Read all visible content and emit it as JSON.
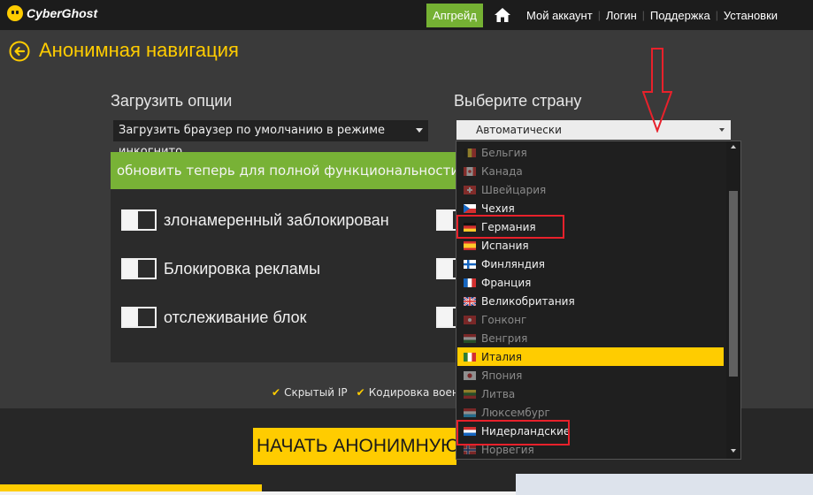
{
  "header": {
    "brand": "CyberGhost",
    "upgrade_label": "Апгрейд",
    "nav": [
      "Мой аккаунт",
      "Логин",
      "Поддержка",
      "Установки"
    ]
  },
  "page": {
    "title": "Анонимная навигация"
  },
  "load_options": {
    "label": "Загрузить опции",
    "selected": "Загрузить браузер по умолчанию в режиме инкогнито"
  },
  "upgrade_banner": "обновить теперь для полной функциональности",
  "features": [
    {
      "label": "злонамеренный заблокирован"
    },
    {
      "label": "Блокировка рекламы"
    },
    {
      "label": "отслеживание блок"
    }
  ],
  "checks": [
    "Скрытый IP",
    "Кодировка военно"
  ],
  "start_button": "НАЧАТЬ АНОНИМНУЮ НАВИГАЦИЮ",
  "country": {
    "label": "Выберите страну",
    "selected": "Автоматически",
    "options": [
      {
        "name": "Бельгия",
        "code": "be",
        "dim": true
      },
      {
        "name": "Канада",
        "code": "ca",
        "dim": true
      },
      {
        "name": "Швейцария",
        "code": "ch",
        "dim": true
      },
      {
        "name": "Чехия",
        "code": "cz",
        "dim": false
      },
      {
        "name": "Германия",
        "code": "de",
        "dim": false
      },
      {
        "name": "Испания",
        "code": "es",
        "dim": false
      },
      {
        "name": "Финляндия",
        "code": "fi",
        "dim": false
      },
      {
        "name": "Франция",
        "code": "fr",
        "dim": false
      },
      {
        "name": "Великобритания",
        "code": "gb",
        "dim": false
      },
      {
        "name": "Гонконг",
        "code": "hk",
        "dim": true
      },
      {
        "name": "Венгрия",
        "code": "hu",
        "dim": true
      },
      {
        "name": "Италия",
        "code": "it",
        "dim": false,
        "selected": true
      },
      {
        "name": "Япония",
        "code": "jp",
        "dim": true
      },
      {
        "name": "Литва",
        "code": "lt",
        "dim": true
      },
      {
        "name": "Люксембург",
        "code": "lu",
        "dim": true
      },
      {
        "name": "Нидерландские",
        "code": "nl",
        "dim": false
      },
      {
        "name": "Норвегия",
        "code": "no",
        "dim": true
      }
    ],
    "highlighted": [
      "Германия",
      "Нидерландские"
    ]
  },
  "colors": {
    "accent_yellow": "#ffcc00",
    "upgrade_green": "#75b133",
    "highlight_red": "#e8212b"
  }
}
